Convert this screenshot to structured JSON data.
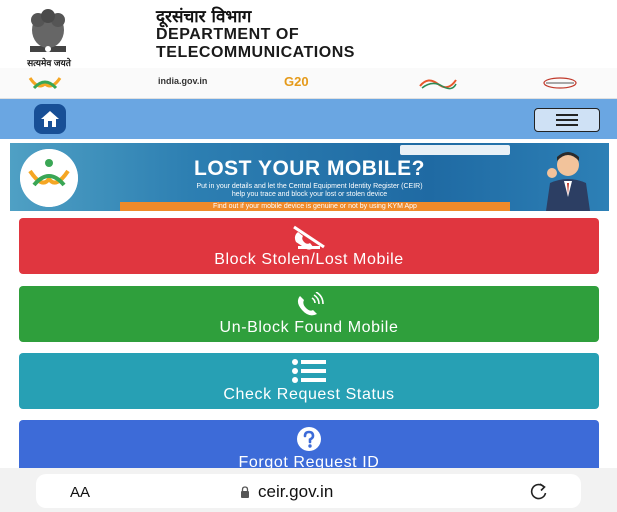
{
  "header": {
    "emblem_caption": "सत्यमेव जयते",
    "title_hindi": "दूरसंचार विभाग",
    "title_line1": "DEPARTMENT OF",
    "title_line2": "TELECOMMUNICATIONS"
  },
  "logos": {
    "india_gov": "india.gov.in",
    "g20": "G20"
  },
  "banner": {
    "title": "LOST YOUR MOBILE?",
    "subtitle1": "Put in your details and let the Central Equipment Identity Register (CEIR)",
    "subtitle2": "help you trace and block your lost or stolen device",
    "strip": "Find out if your mobile device is genuine or not by using KYM App"
  },
  "actions": {
    "block": "Block Stolen/Lost Mobile",
    "unblock": "Un-Block Found Mobile",
    "check": "Check Request Status",
    "forgot": "Forgot Request ID"
  },
  "browser": {
    "text_size": "AA",
    "url": "ceir.gov.in"
  },
  "colors": {
    "navbar": "#6aa6e2",
    "home_button": "#184f96",
    "block": "#e0363f",
    "unblock": "#2f9f3c",
    "check": "#27a0b4",
    "forgot": "#3d6bd8"
  }
}
